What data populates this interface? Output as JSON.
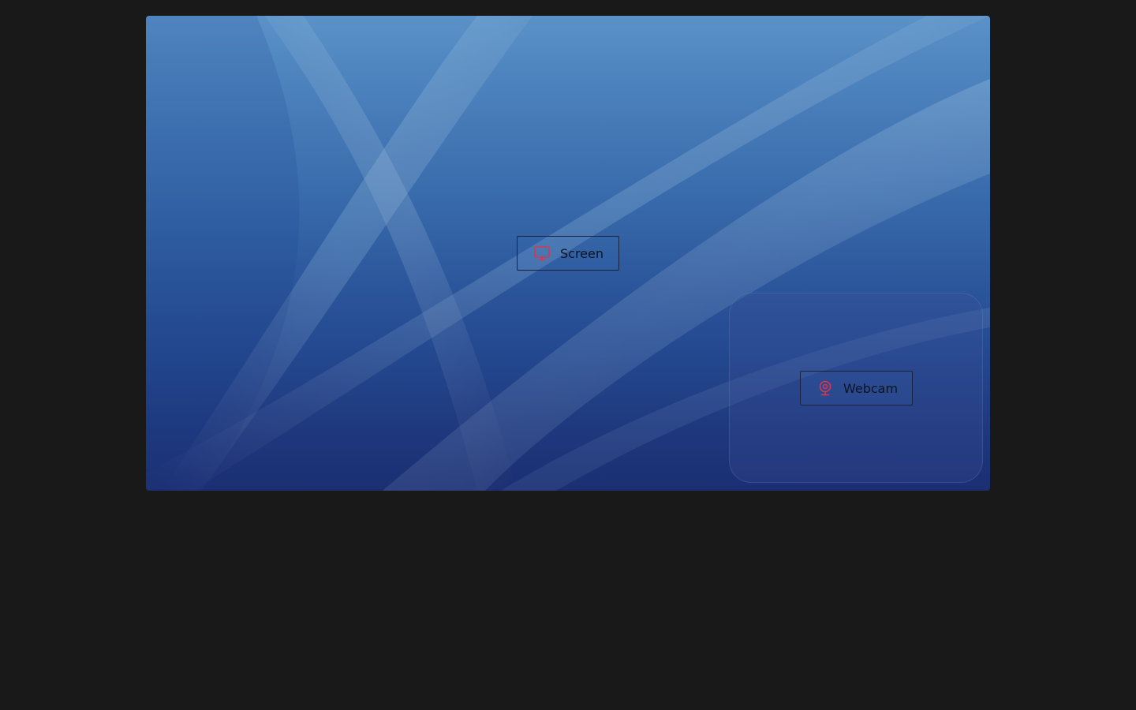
{
  "sources": {
    "screen": {
      "label": "Screen",
      "icon": "monitor-icon"
    },
    "webcam": {
      "label": "Webcam",
      "icon": "webcam-icon"
    }
  },
  "colors": {
    "page_background": "#19191a",
    "icon_accent": "#e0334c",
    "button_border": "#1a2240"
  }
}
